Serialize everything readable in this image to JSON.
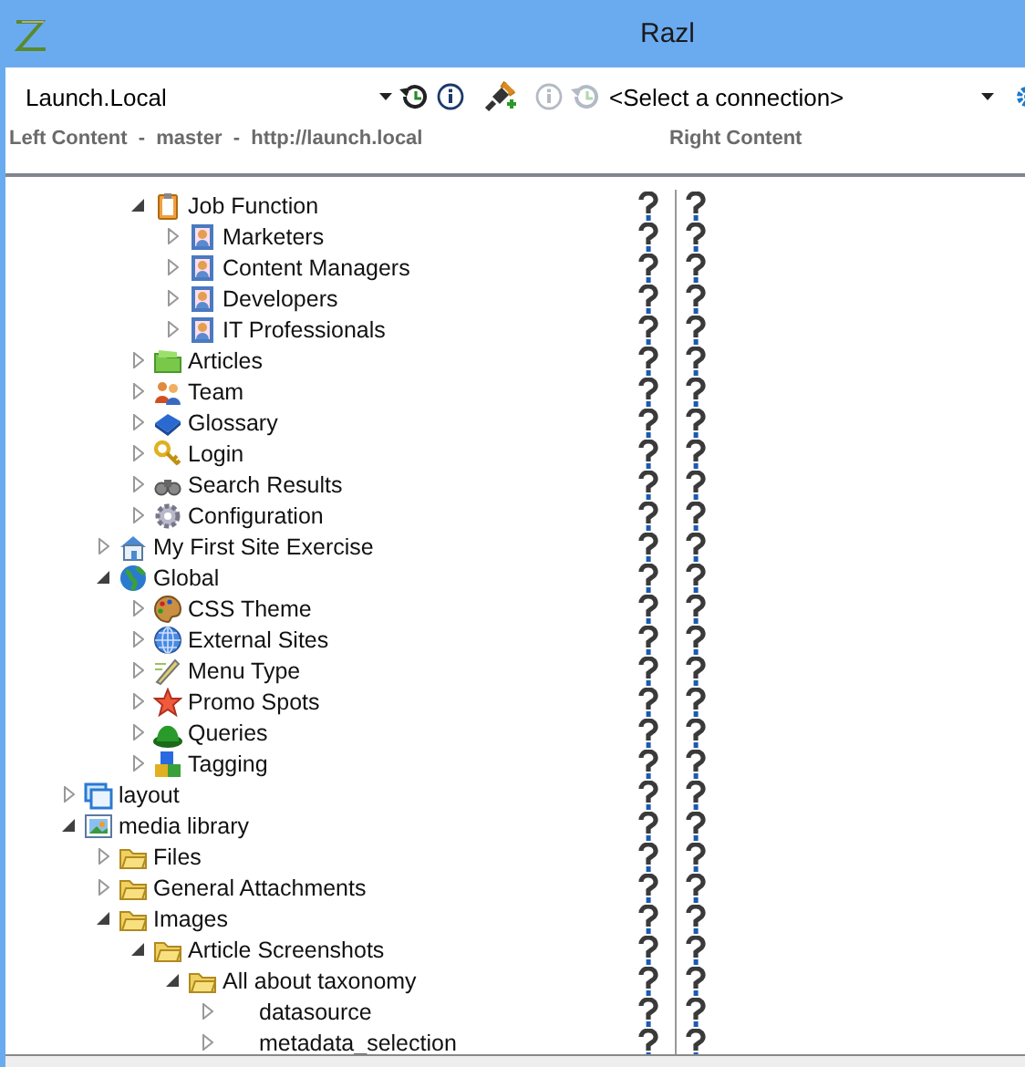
{
  "window": {
    "title": "Razl"
  },
  "toolbar": {
    "left_connection": {
      "value": "Launch.Local"
    },
    "buttons": [
      {
        "kind": "history",
        "disabled": false
      },
      {
        "kind": "info",
        "disabled": false
      },
      {
        "kind": "separator"
      },
      {
        "kind": "plug",
        "disabled": false
      },
      {
        "kind": "separator"
      },
      {
        "kind": "info",
        "disabled": true
      },
      {
        "kind": "history",
        "disabled": true
      }
    ],
    "right_connection": {
      "placeholder": "<Select a connection>"
    }
  },
  "columns": {
    "left": "Left Content  -  master  -  http://launch.local",
    "right": "Right Content"
  },
  "tree": [
    {
      "children": [
        {
          "children": [
            {
              "label": "Job Function",
              "kind": "clipboard",
              "expanded": true,
              "children": [
                {
                  "label": "Marketers",
                  "kind": "person",
                  "expanded": false
                },
                {
                  "label": "Content Managers",
                  "kind": "person",
                  "expanded": false
                },
                {
                  "label": "Developers",
                  "kind": "person",
                  "expanded": false
                },
                {
                  "label": "IT Professionals",
                  "kind": "person",
                  "expanded": false
                }
              ]
            },
            {
              "label": "Articles",
              "kind": "greenfolder",
              "expanded": false
            },
            {
              "label": "Team",
              "kind": "people",
              "expanded": false
            },
            {
              "label": "Glossary",
              "kind": "book",
              "expanded": false
            },
            {
              "label": "Login",
              "kind": "key",
              "expanded": false
            },
            {
              "label": "Search Results",
              "kind": "binoculars",
              "expanded": false
            },
            {
              "label": "Configuration",
              "kind": "gear",
              "expanded": false
            }
          ]
        },
        {
          "label": "My First Site Exercise",
          "kind": "house",
          "expanded": false
        },
        {
          "label": "Global",
          "kind": "globe",
          "expanded": true,
          "children": [
            {
              "label": "CSS Theme",
              "kind": "palette",
              "expanded": false
            },
            {
              "label": "External Sites",
              "kind": "web",
              "expanded": false
            },
            {
              "label": "Menu Type",
              "kind": "pencil",
              "expanded": false
            },
            {
              "label": "Promo Spots",
              "kind": "star",
              "expanded": false
            },
            {
              "label": "Queries",
              "kind": "hat",
              "expanded": false
            },
            {
              "label": "Tagging",
              "kind": "blocks",
              "expanded": false
            }
          ]
        }
      ]
    },
    {
      "label": "layout",
      "kind": "window",
      "expanded": false
    },
    {
      "label": "media library",
      "kind": "picture",
      "expanded": true,
      "children": [
        {
          "label": "Files",
          "kind": "folder",
          "expanded": false
        },
        {
          "label": "General Attachments",
          "kind": "folder",
          "expanded": false
        },
        {
          "label": "Images",
          "kind": "folder",
          "expanded": true,
          "children": [
            {
              "label": "Article Screenshots",
              "kind": "folder",
              "expanded": true,
              "children": [
                {
                  "label": "All about taxonomy",
                  "kind": "folder",
                  "expanded": true,
                  "children": [
                    {
                      "label": "datasource",
                      "kind": "blank",
                      "expanded": false
                    },
                    {
                      "label": "metadata_selection",
                      "kind": "blank",
                      "expanded": false
                    }
                  ]
                }
              ]
            }
          ]
        }
      ]
    }
  ]
}
